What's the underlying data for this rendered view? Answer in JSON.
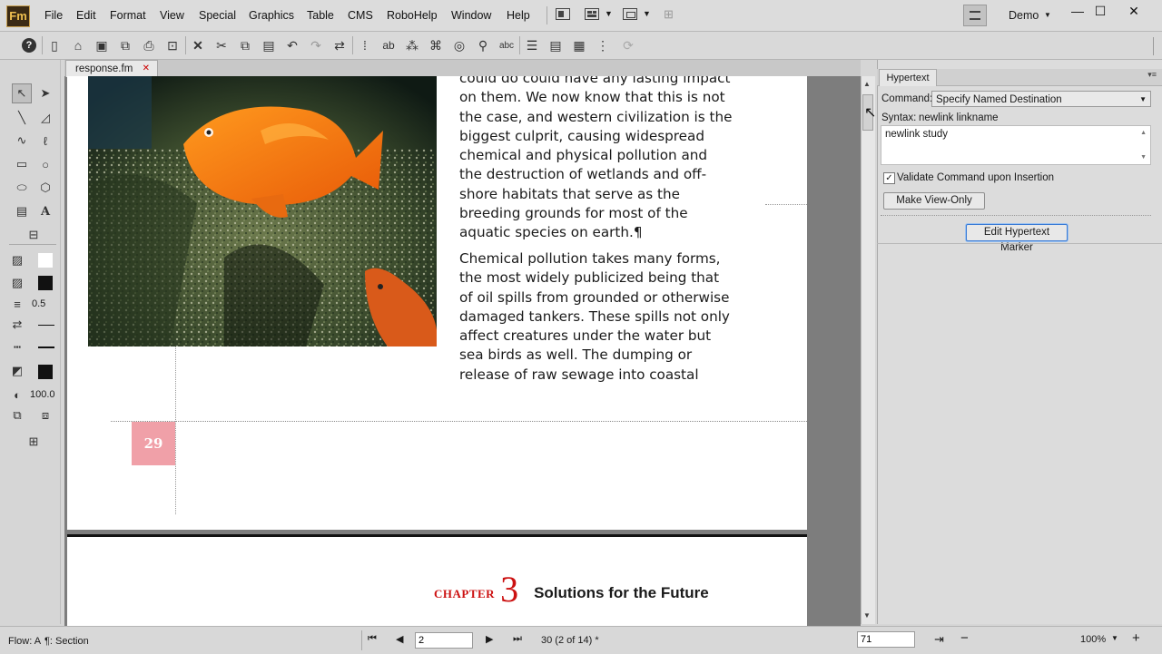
{
  "app": {
    "logo": "Fm",
    "account": "Demo"
  },
  "menu": [
    "File",
    "Edit",
    "Format",
    "View",
    "Special",
    "Graphics",
    "Table",
    "CMS",
    "RoboHelp",
    "Window",
    "Help"
  ],
  "document": {
    "tab_name": "response.fm",
    "paragraph1": [
      "could do could have any lasting impact",
      "on them. We now know that this is not",
      "the case, and western civilization is the",
      "biggest culprit, causing widespread",
      "chemical and physical pollution and",
      "the destruction of wetlands and off-",
      "shore habitats that serve as the",
      "breeding grounds for most of the",
      "aquatic species on earth.¶"
    ],
    "paragraph2": [
      "Chemical pollution takes many forms,",
      "the most widely publicized being that",
      "of oil spills from grounded or otherwise",
      "damaged tankers. These spills not only",
      "affect creatures under the water but",
      "sea birds as well. The dumping or",
      "release of raw sewage into coastal"
    ],
    "page_number": "29",
    "chapter_word": "CHAPTER",
    "chapter_number": "3",
    "chapter_title": "Solutions for the Future"
  },
  "palette": {
    "line_width": "0.5",
    "tint": "100.0"
  },
  "hypertext_panel": {
    "tab": "Hypertext",
    "command_label": "Command:",
    "command_value": "Specify Named Destination",
    "syntax_label": "Syntax:",
    "syntax_value": "newlink linkname",
    "text_value": "newlink study",
    "validate_label": "Validate Command upon Insertion",
    "validate_checked": true,
    "make_view_only": "Make View-Only",
    "edit_marker": "Edit Hypertext Marker"
  },
  "status": {
    "flow": "Flow: A",
    "para": "¶: Section",
    "page_input": "2",
    "page_info": "30 (2 of 14) *",
    "field2": "71",
    "zoom": "100%"
  },
  "colors": {
    "accent_red": "#cc1111",
    "page_marker": "#f0a0a8"
  }
}
